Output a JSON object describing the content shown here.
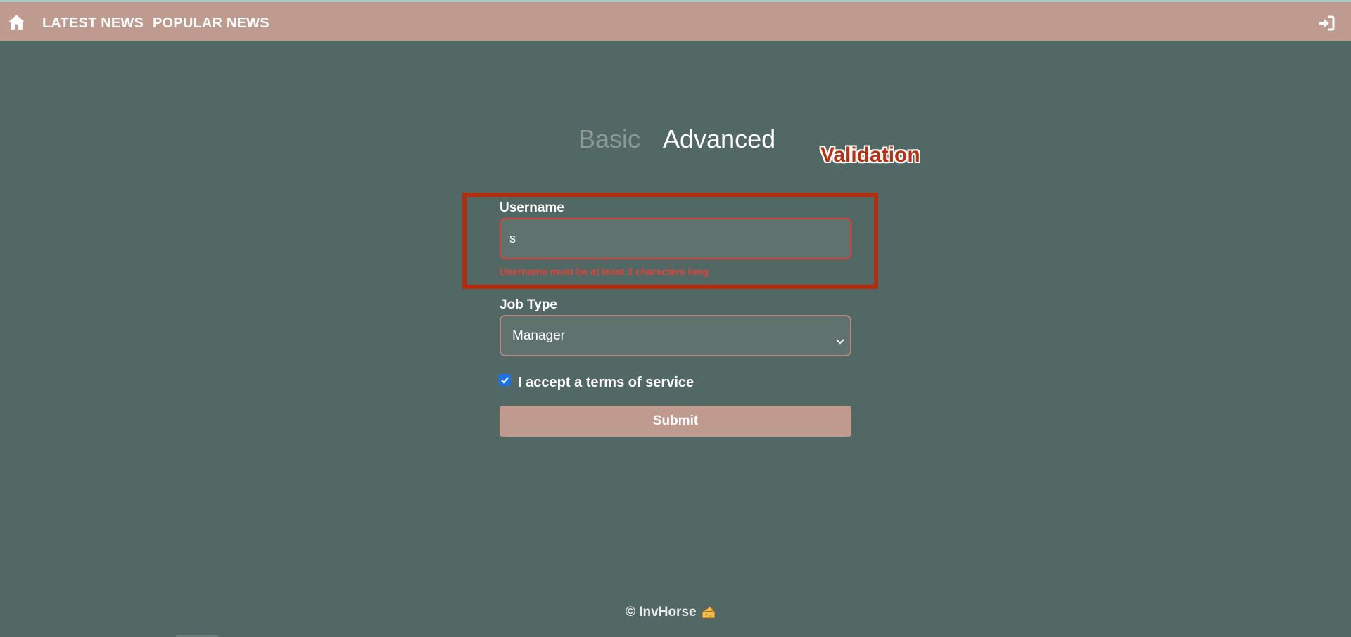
{
  "colors": {
    "background": "#526864",
    "navbar": "#bf9a8f",
    "error": "#e0433c",
    "annotation": "#b02e0e"
  },
  "navbar": {
    "home_icon": "home-icon",
    "links": [
      {
        "label": "LATEST NEWS"
      },
      {
        "label": "POPULAR NEWS"
      }
    ],
    "login_icon": "sign-in-icon"
  },
  "tabs": [
    {
      "label": "Basic",
      "active": false
    },
    {
      "label": "Advanced",
      "active": true
    }
  ],
  "annotation": {
    "label": "Validation"
  },
  "form": {
    "username": {
      "label": "Username",
      "value": "s",
      "error": "Username must be at least 3 characters long"
    },
    "job_type": {
      "label": "Job Type",
      "selected": "Manager"
    },
    "terms": {
      "checked": true,
      "label": "I accept a terms of service"
    },
    "submit_label": "Submit"
  },
  "footer": {
    "text": "© InvHorse",
    "icon": "cheese-icon"
  }
}
